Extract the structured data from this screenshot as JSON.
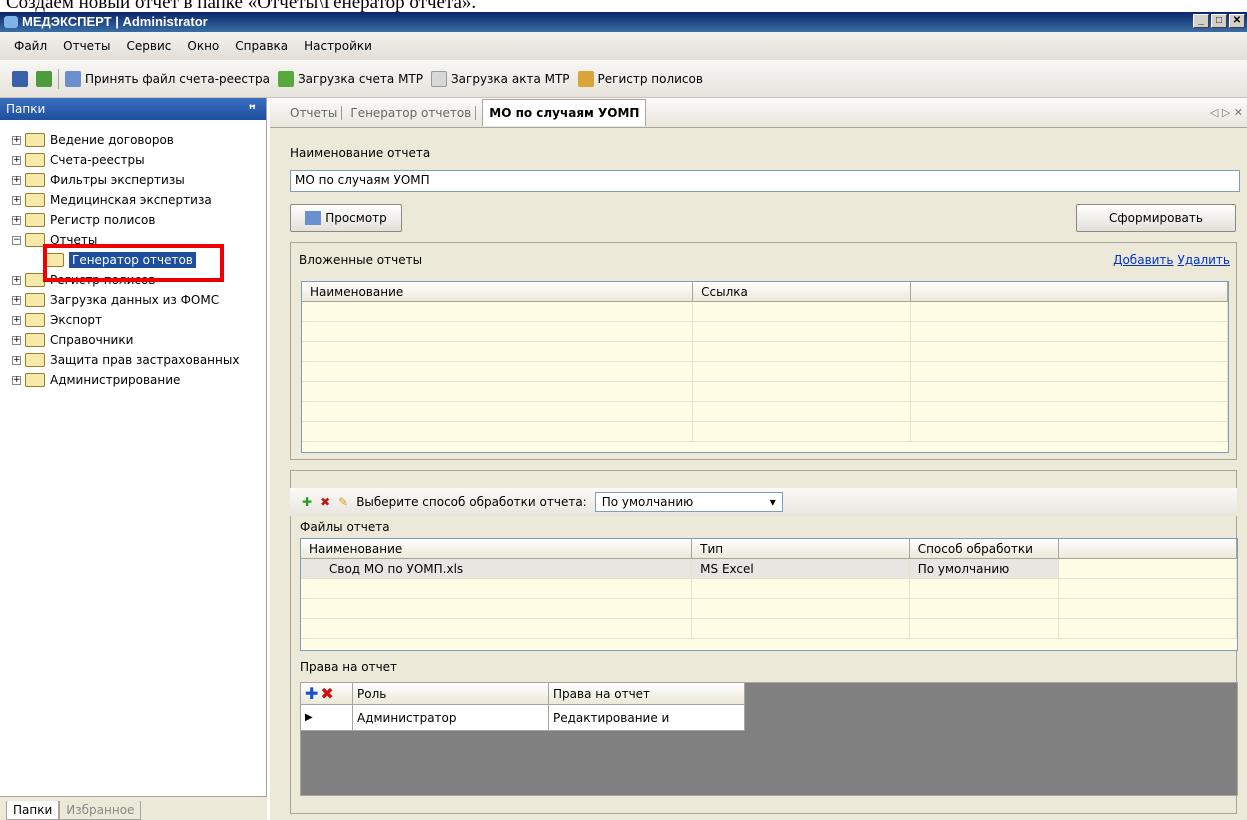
{
  "caption": "Создаем новый отчет в папке «Отчеты\\Генератор отчета».",
  "window": {
    "title": "МЕДЭКСПЕРТ | Administrator"
  },
  "menu": [
    "Файл",
    "Отчеты",
    "Сервис",
    "Окно",
    "Справка",
    "Настройки"
  ],
  "toolbar": {
    "accept_label": "Принять файл счета-реестра",
    "mtr_load_label": "Загрузка счета МТР",
    "mtr_act_label": "Загрузка акта МТР",
    "policies_label": "Регистр полисов"
  },
  "sidebar": {
    "header": "Папки",
    "items": [
      "Ведение договоров",
      "Счета-реестры",
      "Фильтры экспертизы",
      "Медицинская экспертиза",
      "Регистр полисов",
      "Отчеты"
    ],
    "selected_child": "Генератор отчетов",
    "items_after": [
      "Регистр полисов",
      "Загрузка данных из ФОМС",
      "Экспорт",
      "Справочники",
      "Защита прав застрахованных",
      "Администрирование"
    ],
    "bottom_tabs": [
      "Папки",
      "Избранное"
    ]
  },
  "tabs": {
    "t1": "Отчеты",
    "t2": "Генератор отчетов",
    "active": "МО по случаям УОМП"
  },
  "report": {
    "name_label": "Наименование отчета",
    "name_value": "МО по случаям УОМП",
    "preview_button": "Просмотр",
    "generate_button": "Сформировать"
  },
  "nested": {
    "title": "Вложенные отчеты",
    "add_link": "Добавить",
    "delete_link": "Удалить",
    "columns": [
      "Наименование",
      "Ссылка",
      ""
    ]
  },
  "files": {
    "processing_label": "Выберите способ обработки отчета:",
    "processing_value": "По умолчанию",
    "title": "Файлы отчета",
    "columns": [
      "Наименование",
      "Тип",
      "Способ обработки",
      ""
    ],
    "rows": [
      [
        "Свод МО по УОМП.xls",
        "MS Excel",
        "По умолчанию",
        ""
      ]
    ]
  },
  "rights": {
    "title": "Права на отчет",
    "columns": [
      "Роль",
      "Права на отчет"
    ],
    "rows": [
      [
        "Администратор",
        "Редактирование и"
      ]
    ]
  }
}
